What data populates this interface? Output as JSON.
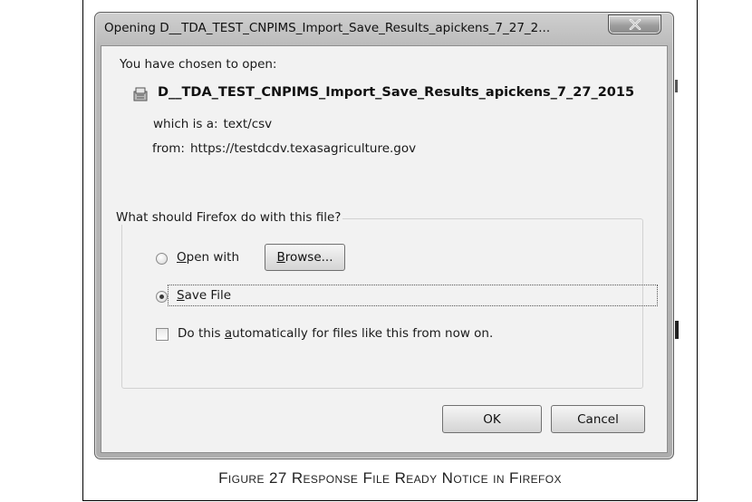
{
  "dialog": {
    "title": "Opening D__TDA_TEST_CNPIMS_Import_Save_Results_apickens_7_27_2...",
    "chosen_label": "You have chosen to open:",
    "file_name": "D__TDA_TEST_CNPIMS_Import_Save_Results_apickens_7_27_2015",
    "type_label": "which is a:",
    "type_value": "text/csv",
    "from_label": "from:",
    "from_value": "https://testdcdv.texasagriculture.gov",
    "question": "What should Firefox do with this file?",
    "open_with": {
      "pre": "",
      "key": "O",
      "post": "pen with",
      "checked": false
    },
    "browse": {
      "key": "B",
      "post": "rowse..."
    },
    "save_file": {
      "key": "S",
      "post": "ave File",
      "checked": true
    },
    "auto": {
      "pre": "Do this ",
      "key": "a",
      "post": "utomatically for files like this from now on.",
      "checked": false
    },
    "ok_label": "OK",
    "cancel_label": "Cancel"
  },
  "caption": {
    "text": "Figure 27 Response File Ready Notice in Firefox"
  }
}
